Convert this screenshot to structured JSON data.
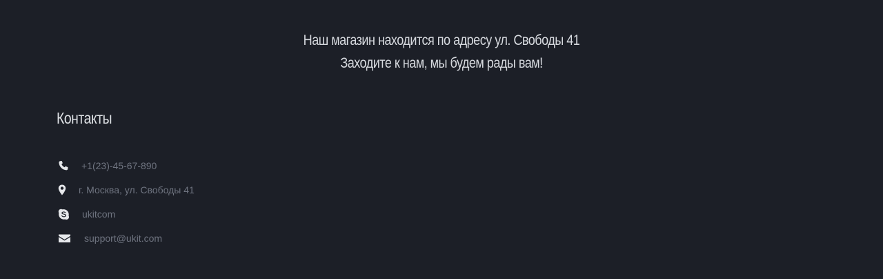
{
  "intro": {
    "line1": "Наш магазин находится по адресу ул. Свободы 41",
    "line2": "Заходите к нам, мы будем рады вам!"
  },
  "contacts": {
    "title": "Контакты",
    "items": [
      {
        "icon": "phone-icon",
        "text": "+1(23)-45-67-890"
      },
      {
        "icon": "map-marker-icon",
        "text": "г. Москва, ул. Свободы 41"
      },
      {
        "icon": "skype-icon",
        "text": "ukitcom"
      },
      {
        "icon": "envelope-icon",
        "text": "support@ukit.com"
      }
    ]
  },
  "colors": {
    "background": "#1c1f27",
    "heading_text": "#dfe2e6",
    "muted_text": "#6f7480",
    "icon": "#e6e8eb"
  }
}
